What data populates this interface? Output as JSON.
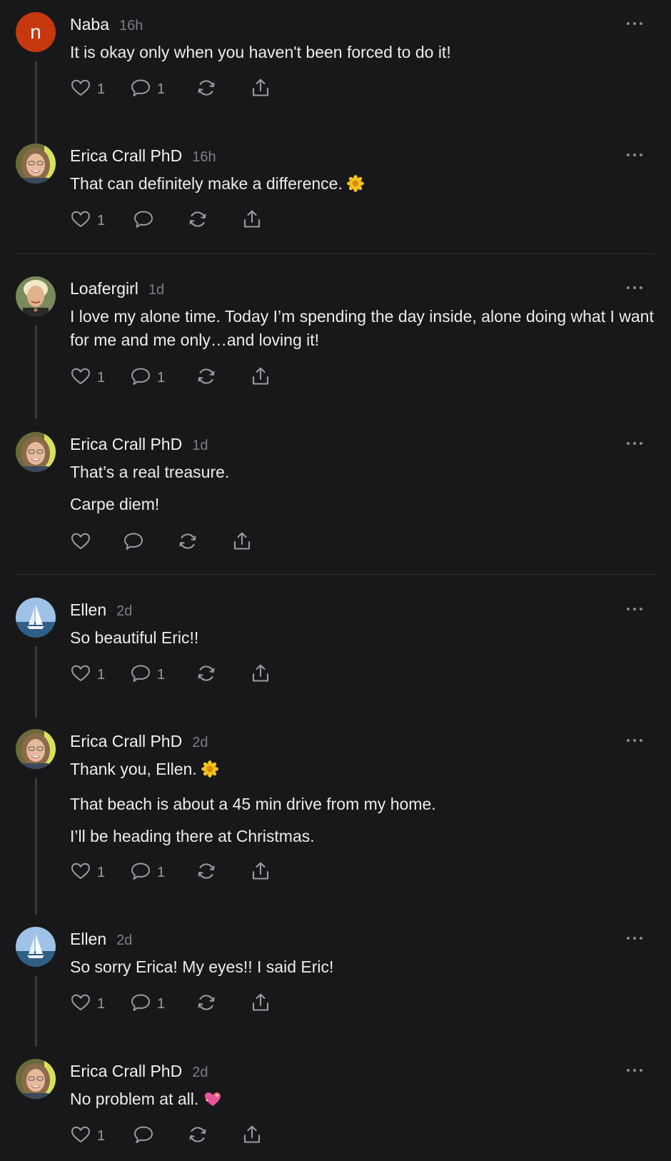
{
  "comments": [
    {
      "author": "Naba",
      "time": "16h",
      "lines": [
        "It is okay only when you haven't been forced to do it!"
      ],
      "likes": "1",
      "replies": "1"
    },
    {
      "author": "Erica Crall PhD",
      "time": "16h",
      "lines": [
        "That can definitely make a difference."
      ],
      "emoji": "flower",
      "likes": "1",
      "replies": ""
    },
    {
      "author": "Loafergirl",
      "time": "1d",
      "lines": [
        "I love my alone time. Today I’m spending the day inside, alone doing what I want for me and me only…and loving it!"
      ],
      "likes": "1",
      "replies": "1"
    },
    {
      "author": "Erica Crall PhD",
      "time": "1d",
      "lines": [
        "That’s a real treasure.",
        "Carpe diem!"
      ],
      "likes": "",
      "replies": ""
    },
    {
      "author": "Ellen",
      "time": "2d",
      "lines": [
        "So beautiful Eric!!"
      ],
      "likes": "1",
      "replies": "1"
    },
    {
      "author": "Erica Crall PhD",
      "time": "2d",
      "lines": [
        "Thank you, Ellen.",
        "That beach is about a 45 min drive from my home.",
        "I’ll be heading there at Christmas."
      ],
      "emoji": "flower",
      "likes": "1",
      "replies": "1"
    },
    {
      "author": "Ellen",
      "time": "2d",
      "lines": [
        "So sorry Erica! My eyes!! I said Eric!"
      ],
      "likes": "1",
      "replies": "1"
    },
    {
      "author": "Erica Crall PhD",
      "time": "2d",
      "lines": [
        "No problem at all."
      ],
      "emoji": "sparkling-heart",
      "likes": "1",
      "replies": ""
    }
  ],
  "avatar_initial": "n",
  "icons": {
    "like": "heart-icon",
    "reply": "comment-bubble-icon",
    "restack": "restack-icon",
    "share": "share-icon",
    "more": "more-dots-icon"
  },
  "colors": {
    "background": "#18181b",
    "naba_avatar": "#c8380f",
    "muted": "#9a9aa0"
  }
}
